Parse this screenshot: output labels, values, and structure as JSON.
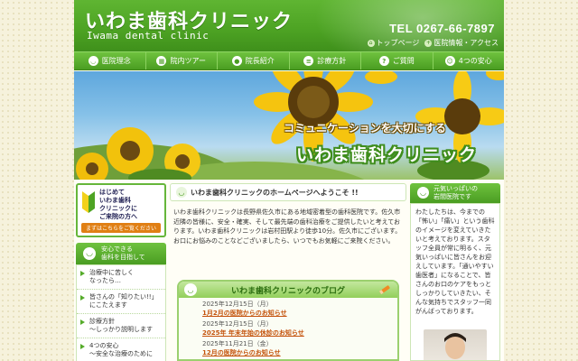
{
  "header": {
    "logo": "いわま歯科クリニック",
    "logo_sub": "Iwama dental clinic",
    "tel": "TEL 0267-66-7897",
    "top_links": [
      {
        "label": "トップページ",
        "icon": "house-icon"
      },
      {
        "label": "医院情報・アクセス",
        "icon": "hospital-icon"
      }
    ]
  },
  "nav": [
    {
      "label": "医院理念",
      "icon": "tooth-icon"
    },
    {
      "label": "院内ツアー",
      "icon": "building-icon"
    },
    {
      "label": "院長紹介",
      "icon": "person-icon"
    },
    {
      "label": "診療方針",
      "icon": "clipboard-icon"
    },
    {
      "label": "ご質問",
      "icon": "question-icon"
    },
    {
      "label": "4つの安心",
      "icon": "smile-icon"
    }
  ],
  "hero": {
    "line1": "コミュニケーションを大切にする",
    "line2": "いわま歯科クリニック"
  },
  "left": {
    "beginner_text": [
      "はじめて",
      "いわま歯科",
      "クリニックに",
      "ご来院の方へ"
    ],
    "beginner_button": "まずはこちらをご覧ください",
    "section_title": [
      "安心できる",
      "歯科を目指して"
    ],
    "items": [
      [
        "治療中に苦しく",
        "なったら…"
      ],
      [
        "皆さんの「知りたい!!」",
        "にこたえます"
      ],
      [
        "診療方針",
        "～しっかり説明します"
      ],
      [
        "4つの安心",
        "～安全な治療のために"
      ]
    ]
  },
  "main": {
    "welcome": "いわま歯科クリニックのホームページへようこそ !!",
    "intro": "いわま歯科クリニックは長野県佐久市にある地域密着型の歯科医院です。佐久市近隣の皆様に、安全・確実、そして最先端の歯科治療をご提供したいと考えております。いわま歯科クリニックは岩村田駅より徒歩10分。佐久市にございます。お口にお悩みのことなどございましたら、いつでもお気軽にご来院ください。",
    "blog_title": "いわま歯科クリニックのブログ",
    "blog": [
      {
        "date": "2025年12月15日（月）",
        "title": "1月2月の医院からのお知らせ"
      },
      {
        "date": "2025年12月15日（月）",
        "title": "2025年 年末年始の休診のお知らせ"
      },
      {
        "date": "2025年11月21日（金）",
        "title": "12月の医院からのお知らせ"
      }
    ]
  },
  "right": {
    "title": [
      "元気いっぱいの",
      "岩間医院です"
    ],
    "body": "わたしたちは、今までの「怖い」「痛い」という歯科のイメージを変えていきたいと考えております。スタッフ全員が常に明るく、元気いっぱいに皆さんをお迎えしています。「通いやすい歯医者」になることで、皆さんのお口のケアをもっとしっかりしていきたい、そんな気持ちでスタッフ一同がんばっております。"
  },
  "colors": {
    "header_green": "#4ea424",
    "accent_orange": "#e07f14",
    "link_orange": "#c4520b",
    "page_bg": "#f6f2dc"
  }
}
